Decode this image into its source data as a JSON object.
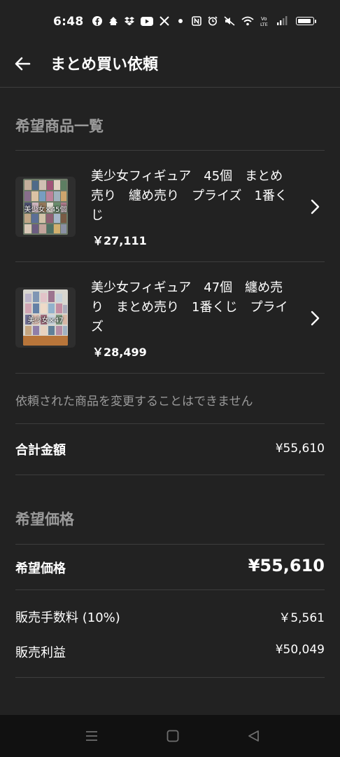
{
  "status_bar": {
    "time": "6:48",
    "icons": [
      "facebook-icon",
      "app-icon",
      "dropbox-icon",
      "youtube-icon",
      "x-icon",
      "dot-icon",
      "nfc-icon",
      "alarm-icon",
      "mute-icon",
      "wifi-icon",
      "volte-icon",
      "signal-icon",
      "battery-icon"
    ],
    "volte_text": "Vo\nLTE",
    "battery_level": 0.95
  },
  "header": {
    "title": "まとめ買い依頼",
    "back_icon": "arrow-left-icon"
  },
  "products_section": {
    "title": "希望商品一覧",
    "items": [
      {
        "title": "美少女フィギュア　45個　まとめ売り　纏め売り　プライズ　1番くじ",
        "price": "￥27,111",
        "thumb_text": "美少女×45個"
      },
      {
        "title": "美少女フィギュア　47個　纏め売り　まとめ売り　1番くじ　プライズ",
        "price": "￥28,499",
        "thumb_text": "美少女×47"
      }
    ],
    "note": "依頼された商品を変更することはできません"
  },
  "total": {
    "label": "合計金額",
    "value": "¥55,610"
  },
  "price_section": {
    "title": "希望価格",
    "desired": {
      "label": "希望価格",
      "value": "¥55,610"
    },
    "fee": {
      "label": "販売手数料 (10%)",
      "value": "￥5,561"
    },
    "profit": {
      "label": "販売利益",
      "value": "¥50,049"
    }
  },
  "nav_bar": {
    "icons": [
      "menu-icon",
      "home-square-icon",
      "back-triangle-icon"
    ]
  },
  "colors": {
    "background": "#222222",
    "divider": "#3d3d3d",
    "muted_text": "#9a9a9a",
    "nav_bar": "#111111"
  }
}
